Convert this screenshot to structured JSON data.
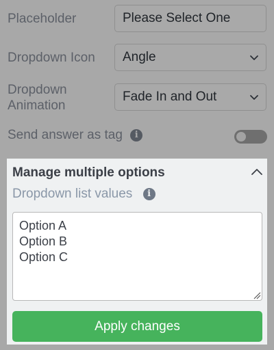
{
  "placeholder_row": {
    "label": "Placeholder",
    "value": "Please Select One"
  },
  "dropdown_icon_row": {
    "label": "Dropdown Icon",
    "value": "Angle",
    "icon": "chevron-down-icon"
  },
  "dropdown_animation_row": {
    "label_line1": "Dropdown",
    "label_line2": "Animation",
    "value": "Fade In and Out",
    "icon": "chevron-down-icon"
  },
  "send_tag_row": {
    "label": "Send answer as tag",
    "info_glyph": "i",
    "toggle_on": false
  },
  "panel": {
    "title": "Manage multiple options",
    "sub_label": "Dropdown list values",
    "info_glyph": "i",
    "textarea_value": "Option A\nOption B\nOption C",
    "apply_label": "Apply changes"
  },
  "colors": {
    "accent_green": "#46b35c",
    "overlay_gray": "#a8a8a8",
    "panel_bg": "#eff1f2"
  }
}
